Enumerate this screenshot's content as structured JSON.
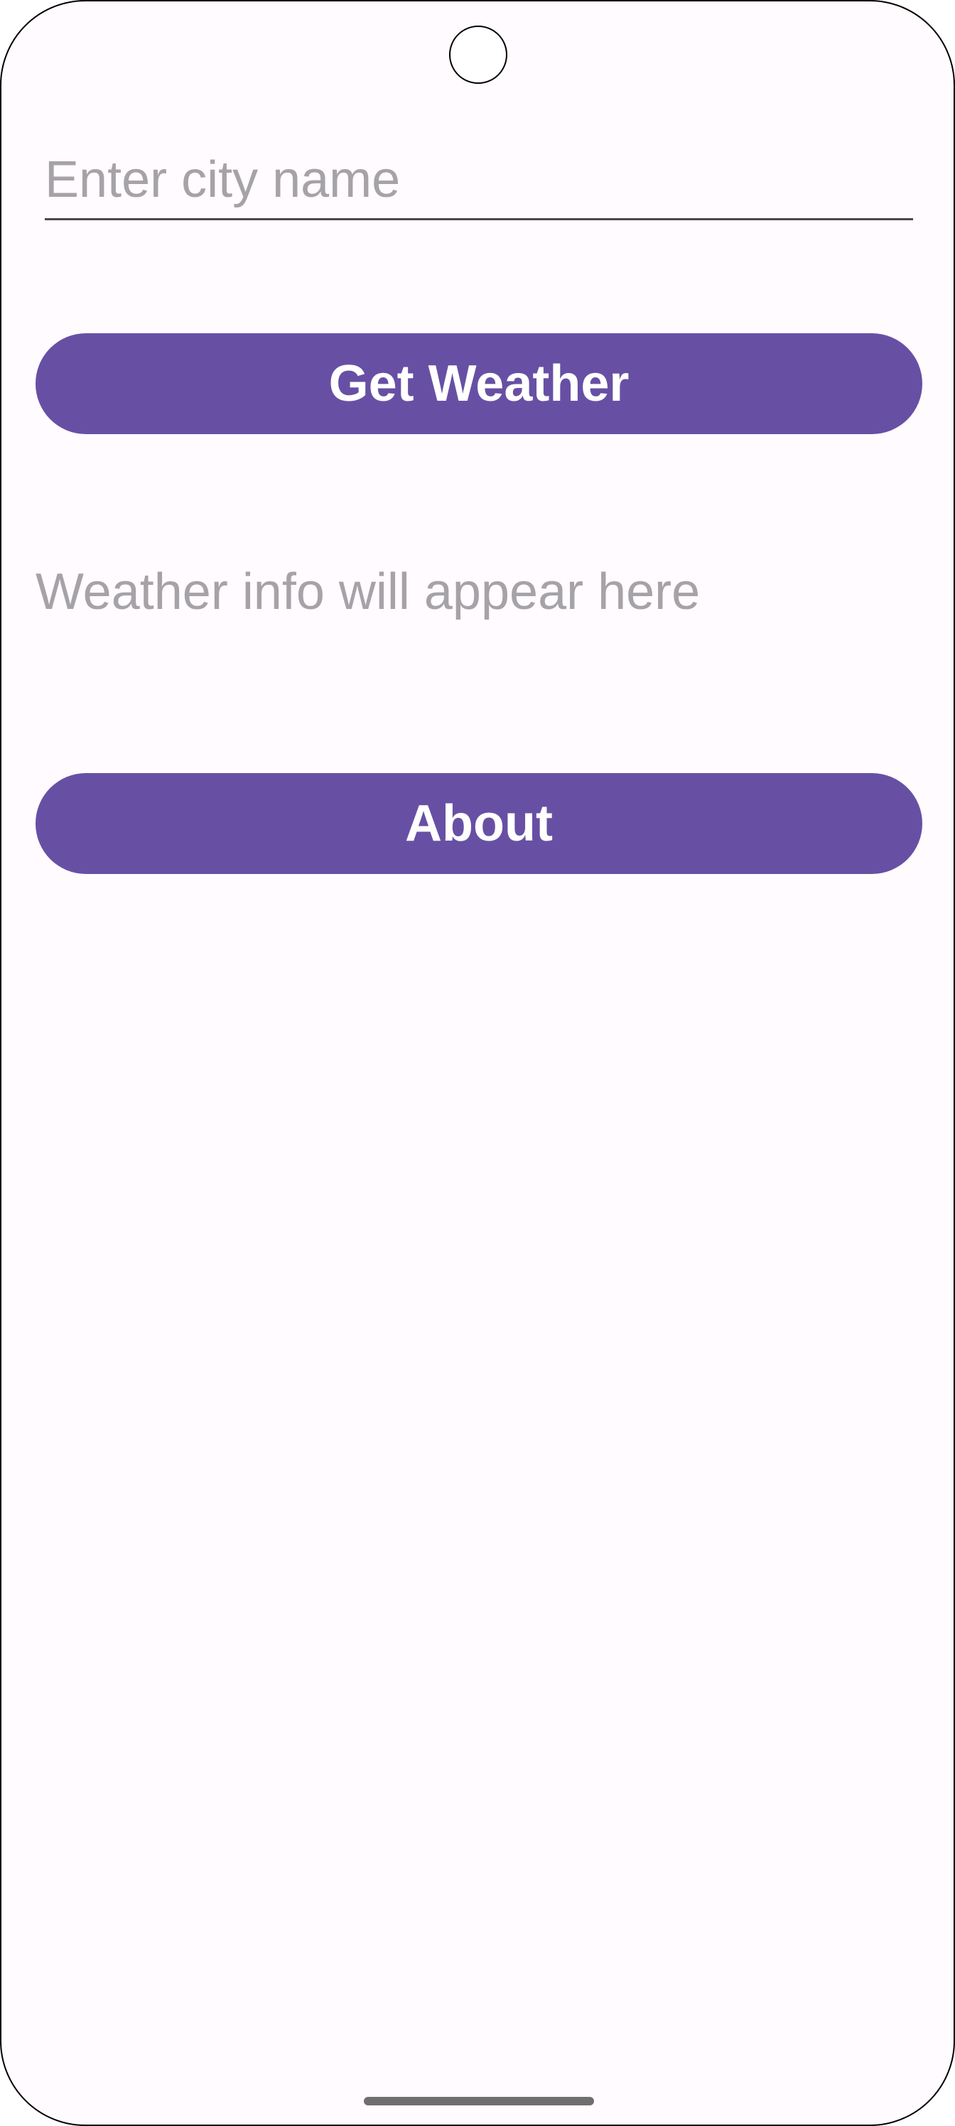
{
  "search": {
    "placeholder": "Enter city name",
    "value": ""
  },
  "actions": {
    "get_weather_label": "Get Weather",
    "about_label": "About"
  },
  "result": {
    "text": "Weather info will appear here"
  },
  "colors": {
    "primary": "#6750a4",
    "background": "#fffbfe",
    "hint_text": "#a6a3a8",
    "on_primary": "#ffffff"
  }
}
